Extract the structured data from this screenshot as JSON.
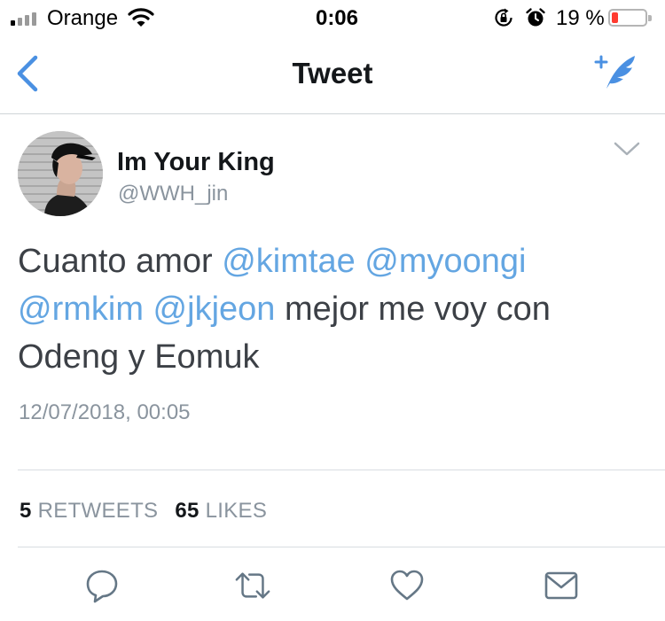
{
  "status_bar": {
    "carrier": "Orange",
    "time": "0:06",
    "battery_percent": "19 %",
    "battery_level": 0.19,
    "icons": [
      "signal-icon",
      "wifi-icon",
      "rotation-lock-icon",
      "alarm-icon",
      "battery-icon"
    ]
  },
  "nav": {
    "title": "Tweet",
    "back_icon": "chevron-left-icon",
    "compose_icon": "compose-tweet-icon",
    "accent_color": "#4a90e2"
  },
  "tweet": {
    "display_name": "Im Your King",
    "handle": "@WWH_jin",
    "text_segments": [
      {
        "text": "Cuanto amor ",
        "type": "text"
      },
      {
        "text": "@kimtae",
        "type": "mention"
      },
      {
        "text": " ",
        "type": "text"
      },
      {
        "text": "@myoongi",
        "type": "mention"
      },
      {
        "text": " ",
        "type": "text"
      },
      {
        "text": "@rmkim",
        "type": "mention"
      },
      {
        "text": " ",
        "type": "text"
      },
      {
        "text": "@jkjeon",
        "type": "mention"
      },
      {
        "text": " mejor me voy con Odeng y Eomuk",
        "type": "text"
      }
    ],
    "timestamp": "12/07/2018, 00:05",
    "mention_color": "#64a6e2"
  },
  "stats": {
    "retweets_count": "5",
    "retweets_label": "RETWEETS",
    "likes_count": "65",
    "likes_label": "LIKES"
  },
  "actions": [
    "reply-icon",
    "retweet-icon",
    "like-icon",
    "share-icon"
  ]
}
